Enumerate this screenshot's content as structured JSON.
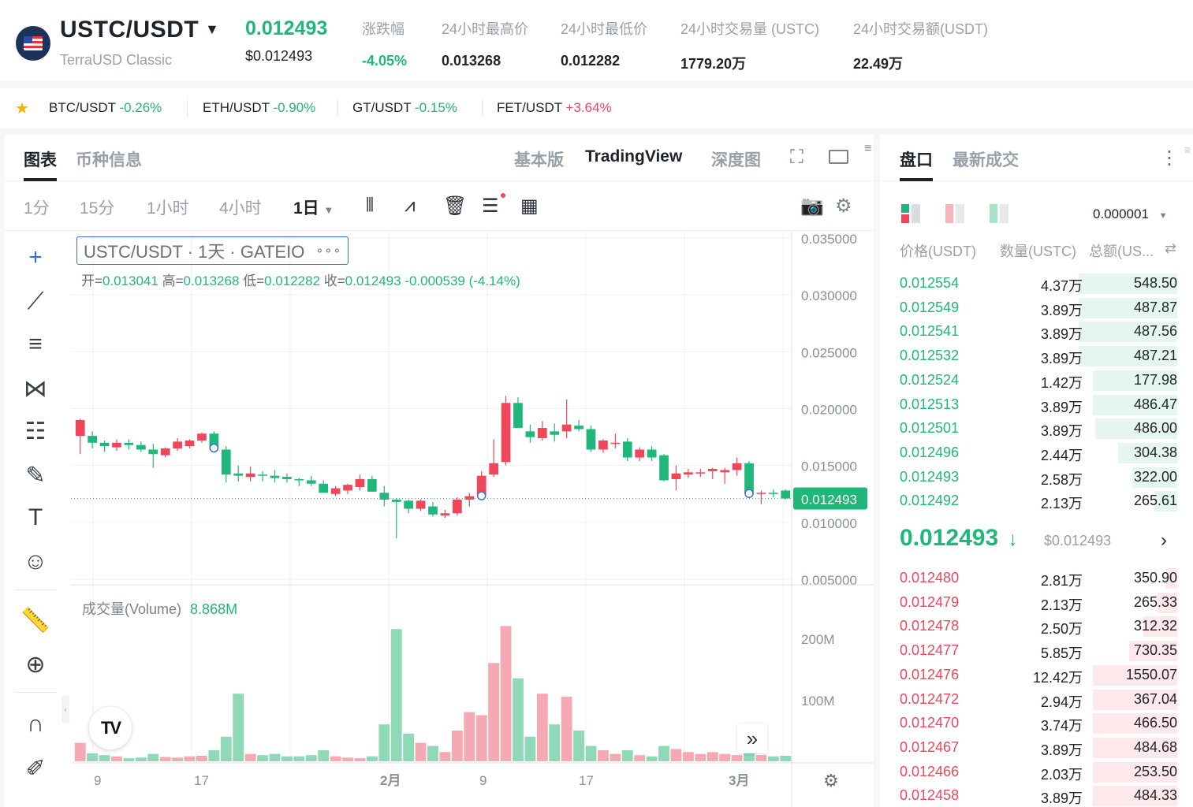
{
  "header": {
    "pair": "USTC/USDT",
    "pair_caret": "▼",
    "full_name": "TerraUSD Classic",
    "last_price": "0.012493",
    "last_price_usd": "$0.012493",
    "stats": [
      {
        "label": "涨跌幅",
        "value": "-4.05%",
        "color": "#1fb87a"
      },
      {
        "label": "24小时最高价",
        "value": "0.013268",
        "color": "#1e2329"
      },
      {
        "label": "24小时最低价",
        "value": "0.012282",
        "color": "#1e2329"
      },
      {
        "label": "24小时交易量 (USTC)",
        "value": "1779.20万",
        "color": "#1e2329"
      },
      {
        "label": "24小时交易额(USDT)",
        "value": "22.49万",
        "color": "#1e2329"
      }
    ]
  },
  "ticker": [
    {
      "pair": "BTC/USDT",
      "change": "-0.26%",
      "dir": "down"
    },
    {
      "pair": "ETH/USDT",
      "change": "-0.90%",
      "dir": "down"
    },
    {
      "pair": "GT/USDT",
      "change": "-0.15%",
      "dir": "down"
    },
    {
      "pair": "FET/USDT",
      "change": "+3.64%",
      "dir": "up"
    }
  ],
  "chart_tabs": {
    "chart": "图表",
    "coin_info": "币种信息",
    "basic": "基本版",
    "tradingview": "TradingView",
    "depth": "深度图"
  },
  "timeframes": [
    "1分",
    "15分",
    "1小时",
    "4小时"
  ],
  "timeframe_active": "1日",
  "legend": {
    "title": "USTC/USDT · 1天 · GATEIO",
    "dots": "∘∘∘",
    "open_label": "开=",
    "open": "0.013041",
    "high_label": "高=",
    "high": "0.013268",
    "low_label": "低=",
    "low": "0.012282",
    "close_label": "收=",
    "close": "0.012493",
    "change": "-0.000539 (-4.14%)"
  },
  "volume": {
    "label": "成交量(Volume)",
    "value": "8.868M",
    "axis_ticks": [
      "200M",
      "100M"
    ]
  },
  "colors": {
    "up": "#f0465c",
    "down": "#1fb87a",
    "up_volume": "#f5a9b3",
    "down_volume": "#8fd9b6"
  },
  "chart_data": {
    "type": "candlestick",
    "y_ticks": [
      "0.035000",
      "0.030000",
      "0.025000",
      "0.020000",
      "0.015000",
      "0.010000",
      "0.005000"
    ],
    "ylim": [
      0.005,
      0.035
    ],
    "x_ticks": [
      "9",
      "17",
      "2月",
      "9",
      "17",
      "3月"
    ],
    "current_price_label": "0.012493",
    "candles": [
      {
        "o": 0.0176,
        "h": 0.0191,
        "l": 0.016,
        "c": 0.019,
        "v": 30
      },
      {
        "o": 0.0176,
        "h": 0.018,
        "l": 0.0165,
        "c": 0.017,
        "v": 13
      },
      {
        "o": 0.017,
        "h": 0.0172,
        "l": 0.0162,
        "c": 0.0167,
        "v": 10
      },
      {
        "o": 0.0166,
        "h": 0.0173,
        "l": 0.0163,
        "c": 0.017,
        "v": 8
      },
      {
        "o": 0.017,
        "h": 0.0173,
        "l": 0.0164,
        "c": 0.0168,
        "v": 5
      },
      {
        "o": 0.0168,
        "h": 0.0171,
        "l": 0.0162,
        "c": 0.0164,
        "v": 6
      },
      {
        "o": 0.0164,
        "h": 0.0169,
        "l": 0.0148,
        "c": 0.016,
        "v": 12
      },
      {
        "o": 0.0159,
        "h": 0.0166,
        "l": 0.0157,
        "c": 0.0165,
        "v": 7
      },
      {
        "o": 0.0165,
        "h": 0.0174,
        "l": 0.0163,
        "c": 0.0171,
        "v": 6
      },
      {
        "o": 0.0167,
        "h": 0.0173,
        "l": 0.0165,
        "c": 0.0172,
        "v": 8
      },
      {
        "o": 0.0172,
        "h": 0.0179,
        "l": 0.017,
        "c": 0.0178,
        "v": 9
      },
      {
        "o": 0.0178,
        "h": 0.018,
        "l": 0.0164,
        "c": 0.0164,
        "v": 18
      },
      {
        "o": 0.0164,
        "h": 0.0167,
        "l": 0.0135,
        "c": 0.0142,
        "v": 40
      },
      {
        "o": 0.0143,
        "h": 0.015,
        "l": 0.0136,
        "c": 0.0141,
        "v": 110
      },
      {
        "o": 0.014,
        "h": 0.0149,
        "l": 0.0136,
        "c": 0.0143,
        "v": 12
      },
      {
        "o": 0.0142,
        "h": 0.0145,
        "l": 0.0136,
        "c": 0.0141,
        "v": 10
      },
      {
        "o": 0.0141,
        "h": 0.0146,
        "l": 0.0135,
        "c": 0.0139,
        "v": 12
      },
      {
        "o": 0.014,
        "h": 0.0143,
        "l": 0.0135,
        "c": 0.0138,
        "v": 8
      },
      {
        "o": 0.0138,
        "h": 0.0139,
        "l": 0.0132,
        "c": 0.0137,
        "v": 8
      },
      {
        "o": 0.0137,
        "h": 0.0141,
        "l": 0.0132,
        "c": 0.0134,
        "v": 10
      },
      {
        "o": 0.0134,
        "h": 0.0137,
        "l": 0.0126,
        "c": 0.0126,
        "v": 18
      },
      {
        "o": 0.0125,
        "h": 0.0132,
        "l": 0.0123,
        "c": 0.013,
        "v": 8
      },
      {
        "o": 0.0128,
        "h": 0.0134,
        "l": 0.0125,
        "c": 0.0133,
        "v": 6
      },
      {
        "o": 0.0131,
        "h": 0.0142,
        "l": 0.0128,
        "c": 0.0138,
        "v": 5
      },
      {
        "o": 0.0138,
        "h": 0.0141,
        "l": 0.0127,
        "c": 0.0127,
        "v": 8
      },
      {
        "o": 0.0126,
        "h": 0.0132,
        "l": 0.0114,
        "c": 0.012,
        "v": 60
      },
      {
        "o": 0.012,
        "h": 0.0121,
        "l": 0.0086,
        "c": 0.0118,
        "v": 215
      },
      {
        "o": 0.0119,
        "h": 0.012,
        "l": 0.0108,
        "c": 0.0112,
        "v": 45
      },
      {
        "o": 0.0112,
        "h": 0.012,
        "l": 0.011,
        "c": 0.0119,
        "v": 30
      },
      {
        "o": 0.0114,
        "h": 0.0118,
        "l": 0.0105,
        "c": 0.0107,
        "v": 25
      },
      {
        "o": 0.0106,
        "h": 0.0111,
        "l": 0.0104,
        "c": 0.0108,
        "v": 15
      },
      {
        "o": 0.0108,
        "h": 0.0122,
        "l": 0.0106,
        "c": 0.012,
        "v": 50
      },
      {
        "o": 0.012,
        "h": 0.0126,
        "l": 0.0114,
        "c": 0.0123,
        "v": 80
      },
      {
        "o": 0.0124,
        "h": 0.0145,
        "l": 0.0122,
        "c": 0.0141,
        "v": 75
      },
      {
        "o": 0.0142,
        "h": 0.0173,
        "l": 0.014,
        "c": 0.0152,
        "v": 160
      },
      {
        "o": 0.0153,
        "h": 0.0211,
        "l": 0.015,
        "c": 0.0205,
        "v": 220
      },
      {
        "o": 0.0205,
        "h": 0.021,
        "l": 0.0183,
        "c": 0.0183,
        "v": 135
      },
      {
        "o": 0.018,
        "h": 0.0186,
        "l": 0.017,
        "c": 0.0175,
        "v": 40
      },
      {
        "o": 0.0174,
        "h": 0.0189,
        "l": 0.0172,
        "c": 0.0183,
        "v": 110
      },
      {
        "o": 0.018,
        "h": 0.0187,
        "l": 0.0171,
        "c": 0.0177,
        "v": 60
      },
      {
        "o": 0.018,
        "h": 0.0208,
        "l": 0.0174,
        "c": 0.0186,
        "v": 105
      },
      {
        "o": 0.0185,
        "h": 0.019,
        "l": 0.018,
        "c": 0.0182,
        "v": 50
      },
      {
        "o": 0.0182,
        "h": 0.0185,
        "l": 0.0162,
        "c": 0.0164,
        "v": 25
      },
      {
        "o": 0.0164,
        "h": 0.0173,
        "l": 0.0161,
        "c": 0.0172,
        "v": 18
      },
      {
        "o": 0.0169,
        "h": 0.0178,
        "l": 0.0165,
        "c": 0.017,
        "v": 12
      },
      {
        "o": 0.0171,
        "h": 0.0174,
        "l": 0.0154,
        "c": 0.0157,
        "v": 18
      },
      {
        "o": 0.0157,
        "h": 0.0166,
        "l": 0.0154,
        "c": 0.0164,
        "v": 10
      },
      {
        "o": 0.0164,
        "h": 0.0167,
        "l": 0.0154,
        "c": 0.0157,
        "v": 8
      },
      {
        "o": 0.0159,
        "h": 0.016,
        "l": 0.0136,
        "c": 0.0137,
        "v": 25
      },
      {
        "o": 0.0138,
        "h": 0.015,
        "l": 0.0128,
        "c": 0.0143,
        "v": 20
      },
      {
        "o": 0.0142,
        "h": 0.0147,
        "l": 0.0139,
        "c": 0.0144,
        "v": 15
      },
      {
        "o": 0.0143,
        "h": 0.0147,
        "l": 0.014,
        "c": 0.0144,
        "v": 12
      },
      {
        "o": 0.0145,
        "h": 0.0148,
        "l": 0.0138,
        "c": 0.0147,
        "v": 15
      },
      {
        "o": 0.0144,
        "h": 0.0148,
        "l": 0.0134,
        "c": 0.0146,
        "v": 12
      },
      {
        "o": 0.0146,
        "h": 0.0157,
        "l": 0.0141,
        "c": 0.0152,
        "v": 10
      },
      {
        "o": 0.0152,
        "h": 0.0154,
        "l": 0.0124,
        "c": 0.0125,
        "v": 35
      },
      {
        "o": 0.0126,
        "h": 0.0128,
        "l": 0.0116,
        "c": 0.0126,
        "v": 10
      },
      {
        "o": 0.0126,
        "h": 0.0129,
        "l": 0.0122,
        "c": 0.0125,
        "v": 8
      },
      {
        "o": 0.0128,
        "h": 0.0129,
        "l": 0.012,
        "c": 0.0121,
        "v": 9
      }
    ]
  },
  "book": {
    "tab_active": "盘口",
    "tab_other": "最新成交",
    "more_icon": "more-vertical-icon",
    "precision": "0.000001",
    "precision_caret": "▼",
    "columns": [
      "价格(USDT)",
      "数量(USTC)",
      "总额(US..."
    ],
    "swap_icon": "⇄",
    "asks": [
      {
        "price": "0.012554",
        "qty": "4.37万",
        "total": "548.50",
        "depth": 0.35
      },
      {
        "price": "0.012549",
        "qty": "3.89万",
        "total": "487.87",
        "depth": 0.35
      },
      {
        "price": "0.012541",
        "qty": "3.89万",
        "total": "487.56",
        "depth": 0.35
      },
      {
        "price": "0.012532",
        "qty": "3.89万",
        "total": "487.21",
        "depth": 0.35
      },
      {
        "price": "0.012524",
        "qty": "1.42万",
        "total": "177.98",
        "depth": 0.3
      },
      {
        "price": "0.012513",
        "qty": "3.89万",
        "total": "486.47",
        "depth": 0.3
      },
      {
        "price": "0.012501",
        "qty": "3.89万",
        "total": "486.00",
        "depth": 0.29
      },
      {
        "price": "0.012496",
        "qty": "2.44万",
        "total": "304.38",
        "depth": 0.21
      },
      {
        "price": "0.012493",
        "qty": "2.58万",
        "total": "322.00",
        "depth": 0.16
      },
      {
        "price": "0.012492",
        "qty": "2.13万",
        "total": "265.61",
        "depth": 0.08
      }
    ],
    "mid_price": "0.012493",
    "mid_arrow": "↓",
    "mid_usd": "$0.012493",
    "mid_chevron": "›",
    "bids": [
      {
        "price": "0.012480",
        "qty": "2.81万",
        "total": "350.90",
        "depth": 0.04
      },
      {
        "price": "0.012479",
        "qty": "2.13万",
        "total": "265.33",
        "depth": 0.07
      },
      {
        "price": "0.012478",
        "qty": "2.50万",
        "total": "312.32",
        "depth": 0.12
      },
      {
        "price": "0.012477",
        "qty": "5.85万",
        "total": "730.35",
        "depth": 0.17
      },
      {
        "price": "0.012476",
        "qty": "12.42万",
        "total": "1550.07",
        "depth": 0.3
      },
      {
        "price": "0.012472",
        "qty": "2.94万",
        "total": "367.04",
        "depth": 0.3
      },
      {
        "price": "0.012470",
        "qty": "3.74万",
        "total": "466.50",
        "depth": 0.3
      },
      {
        "price": "0.012467",
        "qty": "3.89万",
        "total": "484.68",
        "depth": 0.3
      },
      {
        "price": "0.012466",
        "qty": "2.03万",
        "total": "253.50",
        "depth": 0.3
      },
      {
        "price": "0.012458",
        "qty": "3.89万",
        "total": "484.33",
        "depth": 0.3
      }
    ]
  }
}
